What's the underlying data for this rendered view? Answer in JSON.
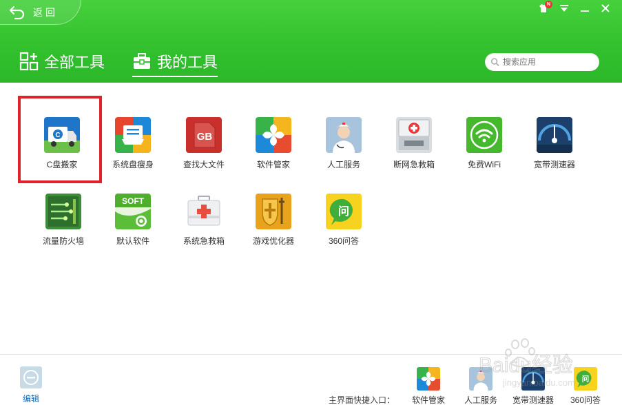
{
  "header": {
    "back_label": "返回",
    "skin_badge": "N",
    "tabs": [
      {
        "label": "全部工具",
        "active": false
      },
      {
        "label": "我的工具",
        "active": true
      }
    ],
    "search_placeholder": "搜索应用"
  },
  "tools": [
    {
      "label": "C盘搬家",
      "icon": "c-drive-move-icon"
    },
    {
      "label": "系统盘瘦身",
      "icon": "system-disk-slim-icon"
    },
    {
      "label": "查找大文件",
      "icon": "find-large-file-icon"
    },
    {
      "label": "软件管家",
      "icon": "software-manager-icon"
    },
    {
      "label": "人工服务",
      "icon": "manual-service-icon"
    },
    {
      "label": "断网急救箱",
      "icon": "network-firstaid-icon"
    },
    {
      "label": "免费WiFi",
      "icon": "free-wifi-icon"
    },
    {
      "label": "宽带测速器",
      "icon": "speed-test-icon"
    },
    {
      "label": "流量防火墙",
      "icon": "traffic-firewall-icon"
    },
    {
      "label": "默认软件",
      "icon": "default-software-icon"
    },
    {
      "label": "系统急救箱",
      "icon": "system-firstaid-icon"
    },
    {
      "label": "游戏优化器",
      "icon": "game-optimizer-icon"
    },
    {
      "label": "360问答",
      "icon": "qa-360-icon"
    }
  ],
  "bottom": {
    "edit_label": "编辑",
    "quick_label": "主界面快捷入口：",
    "quick_items": [
      {
        "label": "软件管家"
      },
      {
        "label": "人工服务"
      },
      {
        "label": "宽带测速器"
      },
      {
        "label": "360问答"
      }
    ]
  },
  "icons_misc": {
    "soft_text": "SOFT",
    "gb_text": "GB",
    "qa_text": "问"
  },
  "watermark": {
    "brand": "Baidu经验",
    "url": "jingyan.baidu.com"
  },
  "colors": {
    "header_green": "#36c42f",
    "highlight_red": "#e0232a",
    "edit_blue": "#1a6cb6"
  }
}
